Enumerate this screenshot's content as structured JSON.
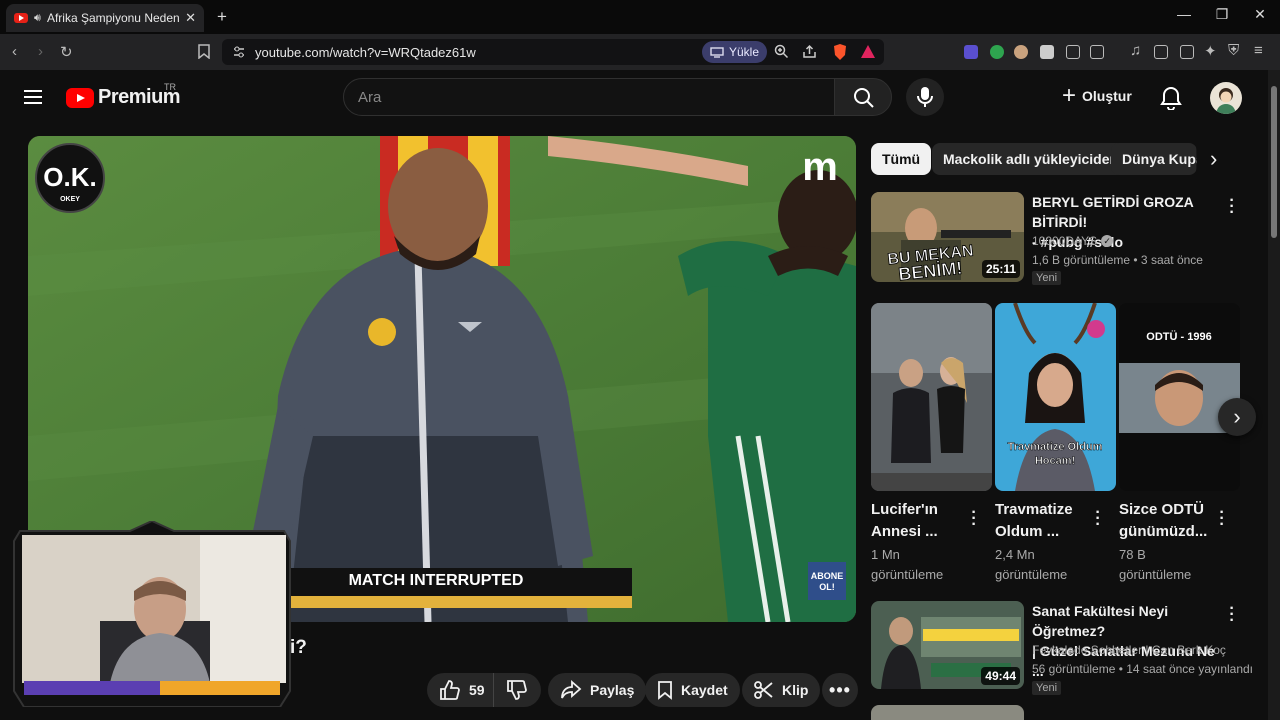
{
  "browser": {
    "tab_title": "Afrika Şampiyonu Neden Değ",
    "tab_close": "✕",
    "new_tab": "+",
    "url": "youtube.com/watch?v=WRQtadez61w",
    "upload_label": "Yükle",
    "minimize": "—",
    "maximize": "❐",
    "close": "✕"
  },
  "header": {
    "logo_text": "Premium",
    "logo_region": "TR",
    "search_placeholder": "Ara",
    "create_label": "Oluştur"
  },
  "video": {
    "channel_logo": "O.K.",
    "channel_logo_sub": "OKEY",
    "banner": "MATCH INTERRUPTED",
    "subscribe_overlay_1": "ABONE",
    "subscribe_overlay_2": "OL!",
    "corner_brand": "m",
    "title_fragment": "i?"
  },
  "actions": {
    "like_count": "59",
    "share_label": "Paylaş",
    "save_label": "Kaydet",
    "clip_label": "Klip"
  },
  "filters": {
    "chips": [
      "Tümü",
      "Mackolik adlı yükleyiciden",
      "Dünya Kupa"
    ]
  },
  "recommendations": [
    {
      "title_line1": "BERYL GETİRDİ GROZA BİTİRDİ!",
      "title_line2": "- #pubg #solo",
      "channel": "10000DAYS",
      "meta": "1,6 B görüntüleme • 3 saat önce",
      "badge": "Yeni",
      "duration": "25:11",
      "thumb_text_1": "BU MEKAN",
      "thumb_text_2": "BENİM!"
    },
    {
      "title_line1": "Sanat Fakültesi Neyi Öğretmez?",
      "title_line2": "| Güzel Sanatlar Mezunu Ne ...",
      "channel": "Fevkalade Sohbetler | Can Berk Koç",
      "meta": "56 görüntüleme • 14 saat önce yayınlandı",
      "badge": "Yeni",
      "duration": "49:44"
    }
  ],
  "shorts": [
    {
      "title_line1": "Lucifer'ın",
      "title_line2": "Annesi ...",
      "views_line1": "1 Mn",
      "views_line2": "görüntüleme"
    },
    {
      "title_line1": "Travmatize",
      "title_line2": "Oldum ...",
      "views_line1": "2,4 Mn",
      "views_line2": "görüntüleme",
      "overlay": "Travmatize Oldum Hocam!"
    },
    {
      "title_line1": "Sizce ODTÜ",
      "title_line2": "günümüzd...",
      "views_line1": "78 B",
      "views_line2": "görüntüleme",
      "overlay": "ODTÜ - 1996"
    }
  ],
  "colors": {
    "background": "#0f0f0f",
    "accent_red": "#ff0000",
    "chip_active": "#f1f1f1"
  }
}
